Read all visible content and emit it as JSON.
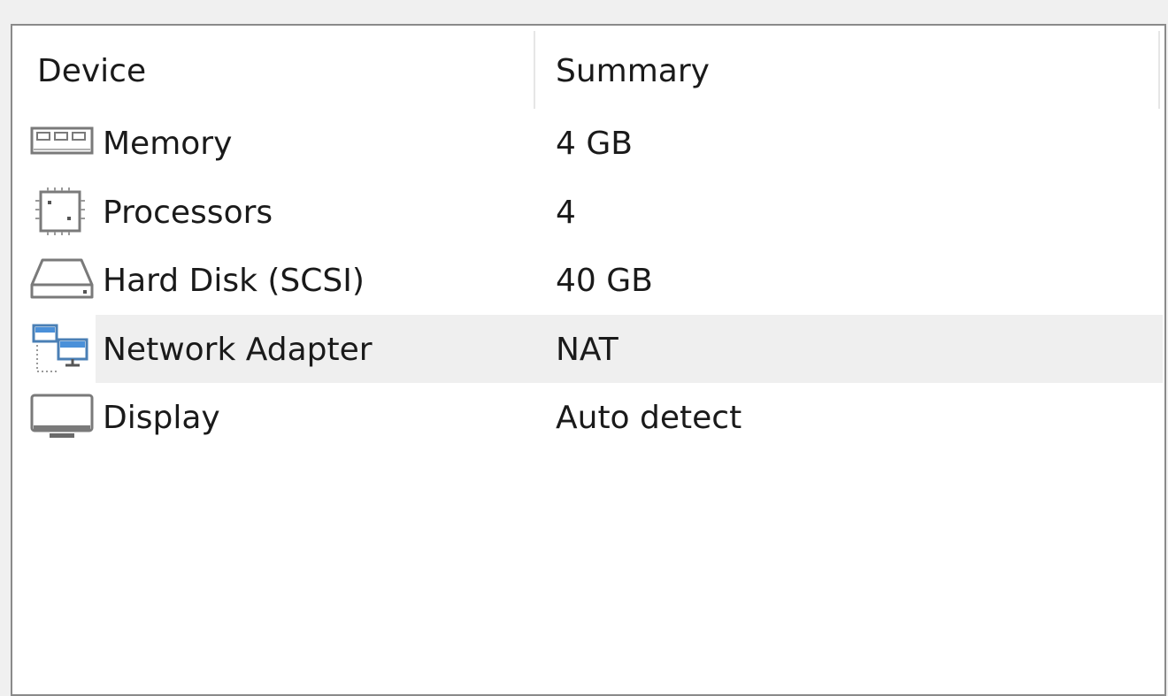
{
  "table": {
    "columns": {
      "device": "Device",
      "summary": "Summary"
    },
    "rows": [
      {
        "device": "Memory",
        "summary": "4 GB",
        "icon": "memory-icon"
      },
      {
        "device": "Processors",
        "summary": "4",
        "icon": "processor-icon"
      },
      {
        "device": "Hard Disk (SCSI)",
        "summary": "40 GB",
        "icon": "hard-disk-icon"
      },
      {
        "device": "Network Adapter",
        "summary": "NAT",
        "icon": "network-adapter-icon"
      },
      {
        "device": "Display",
        "summary": "Auto detect",
        "icon": "display-icon"
      }
    ],
    "hover_row_index": 3
  },
  "colors": {
    "hover_bg": "#efefef",
    "border": "#8a8a8a",
    "window_bg": "#f0f0f0",
    "icon_stroke": "#7a7a7a",
    "icon_accent": "#4a90d9"
  }
}
